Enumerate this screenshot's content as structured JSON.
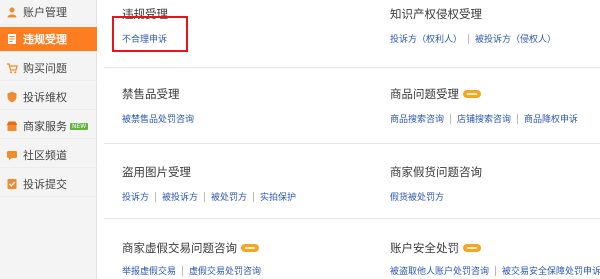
{
  "sidebar": {
    "items": [
      {
        "label": "账户管理",
        "icon": "person-icon",
        "active": false
      },
      {
        "label": "违规受理",
        "icon": "document-icon",
        "active": true
      },
      {
        "label": "购买问题",
        "icon": "cart-icon",
        "active": false
      },
      {
        "label": "投诉维权",
        "icon": "shield-icon",
        "active": false
      },
      {
        "label": "商家服务",
        "icon": "store-icon",
        "active": false,
        "badge": "NEW"
      },
      {
        "label": "社区频道",
        "icon": "community-icon",
        "active": false
      },
      {
        "label": "投诉提交",
        "icon": "submit-icon",
        "active": false
      }
    ]
  },
  "sections": [
    {
      "title": "违规受理",
      "links": [
        "不合理申诉"
      ]
    },
    {
      "title": "知识产权侵权受理",
      "links": [
        "投诉方（权利人）",
        "被投诉方（侵权人）"
      ]
    },
    {
      "title": "禁售品受理",
      "links": [
        "被禁售品处罚咨询"
      ],
      "tag": true
    },
    {
      "title": "商品问题受理",
      "links": [
        "商品搜索咨询",
        "店铺搜索咨询",
        "商品降权申诉"
      ],
      "tag": true
    },
    {
      "title": "盗用图片受理",
      "links": [
        "投诉方",
        "被投诉方",
        "被处罚方",
        "实拍保护"
      ]
    },
    {
      "title": "商家假货问题咨询",
      "links": [
        "假货被处罚方"
      ]
    },
    {
      "title": "商家虚假交易问题咨询",
      "links": [
        "举报虚假交易",
        "虚假交易处罚咨询"
      ],
      "tag": true
    },
    {
      "title": "账户安全处罚",
      "links": [
        "被盗取他人账户处罚咨询",
        "被交易安全保障处罚申诉"
      ],
      "tag": true
    }
  ],
  "colors": {
    "accent": "#ff7d21",
    "link": "#2b57b8",
    "highlight": "#e8141b",
    "badge": "#63b33f"
  }
}
